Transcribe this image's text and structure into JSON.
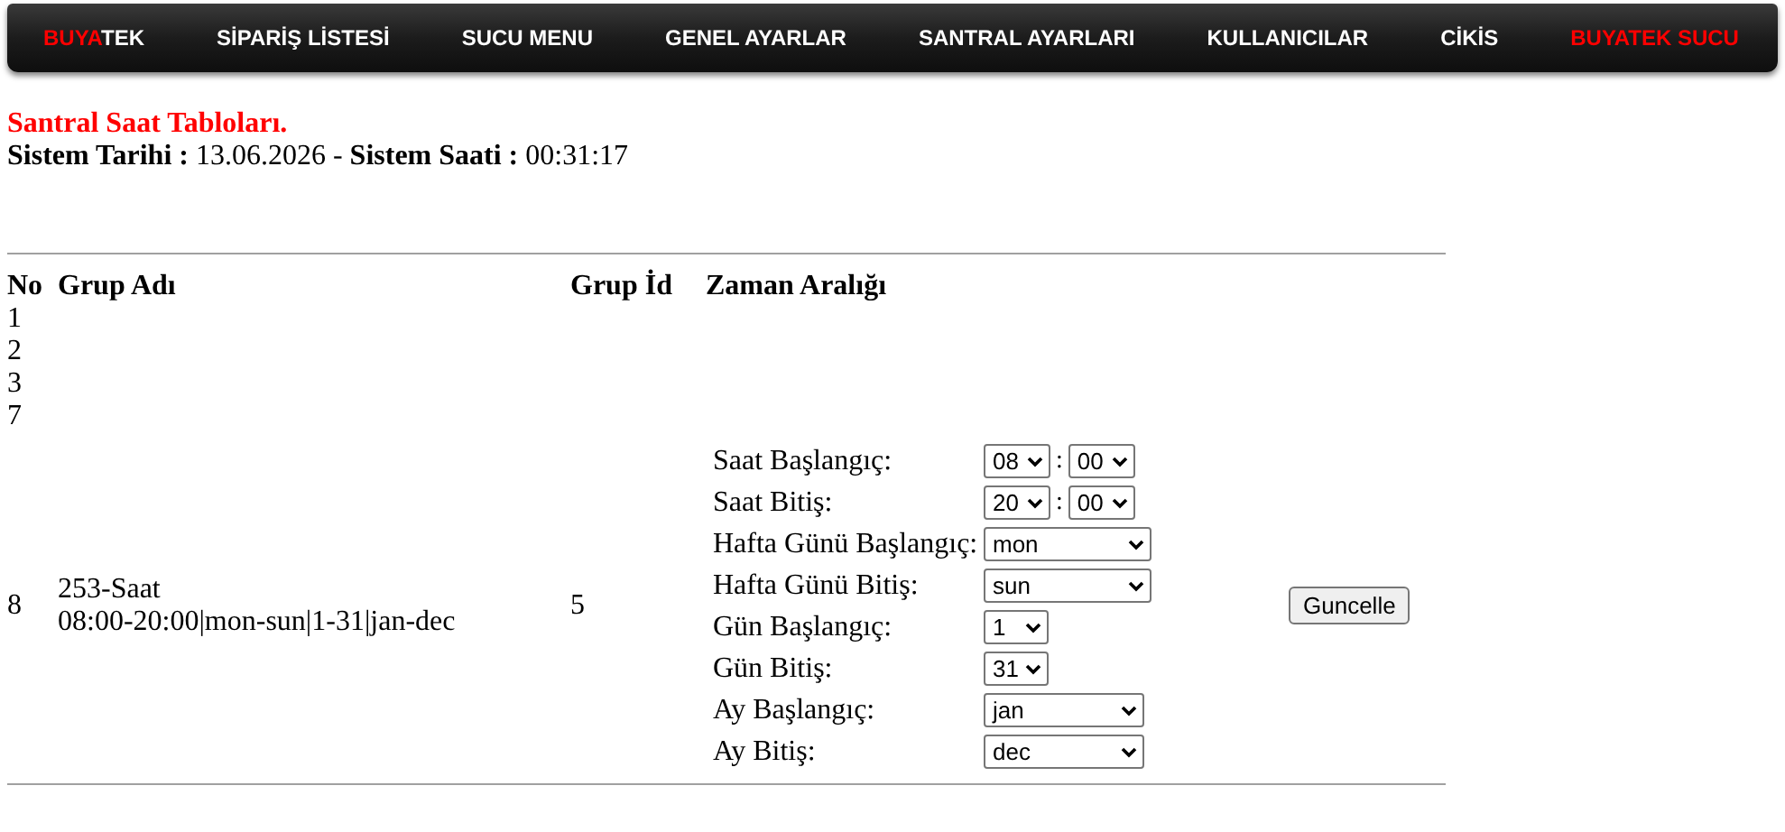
{
  "nav": {
    "logo": [
      "BUYA",
      "TEK"
    ],
    "items": [
      {
        "label": "SİPARİŞ LİSTESİ",
        "highlighted": false
      },
      {
        "label": "SUCU MENU",
        "highlighted": false
      },
      {
        "label": "GENEL AYARLAR",
        "highlighted": false
      },
      {
        "label": "SANTRAL AYARLARI",
        "highlighted": false
      },
      {
        "label": "KULLANICILAR",
        "highlighted": false
      },
      {
        "label": "CİKİS",
        "highlighted": false
      },
      {
        "label": "BUYATEK SUCU",
        "highlighted": true
      }
    ]
  },
  "heading": "Santral Saat Tabloları.",
  "system_info": "**Sistem Tarihi :** 13.06.2026 - **Sistem Saati :** 00:31:17",
  "table": {
    "columns": [
      "No",
      "Grup Adı",
      "Grup İd",
      "Zaman Aralığı"
    ],
    "rows": [
      {
        "no": "1"
      },
      {
        "no": "2"
      },
      {
        "no": "3"
      },
      {
        "no": "7"
      },
      {
        "no": "8",
        "name": [
          "253-Saat",
          "08:00-20:00|mon-sun|1-31|jan-dec"
        ],
        "group_id": "5",
        "schedule": [
          {
            "label": "Saat Başlangıç:",
            "kind": "time",
            "values": [
              "08",
              "00"
            ],
            "separator": ":"
          },
          {
            "label": "Saat Bitiş:",
            "kind": "time",
            "values": [
              "20",
              "00"
            ],
            "separator": ":"
          },
          {
            "label": "Hafta Günü Başlangıç:",
            "kind": "wide",
            "values": [
              "mon"
            ]
          },
          {
            "label": "Hafta Günü Bitiş:",
            "kind": "wide",
            "values": [
              "sun"
            ]
          },
          {
            "label": "Gün Başlangıç:",
            "kind": "small",
            "values": [
              "1"
            ]
          },
          {
            "label": "Gün Bitiş:",
            "kind": "small",
            "values": [
              "31"
            ]
          },
          {
            "label": "Ay Başlangıç:",
            "kind": "medium",
            "values": [
              "jan"
            ]
          },
          {
            "label": "Ay Bitiş:",
            "kind": "medium",
            "values": [
              "dec"
            ]
          }
        ],
        "button": "Guncelle"
      }
    ]
  }
}
